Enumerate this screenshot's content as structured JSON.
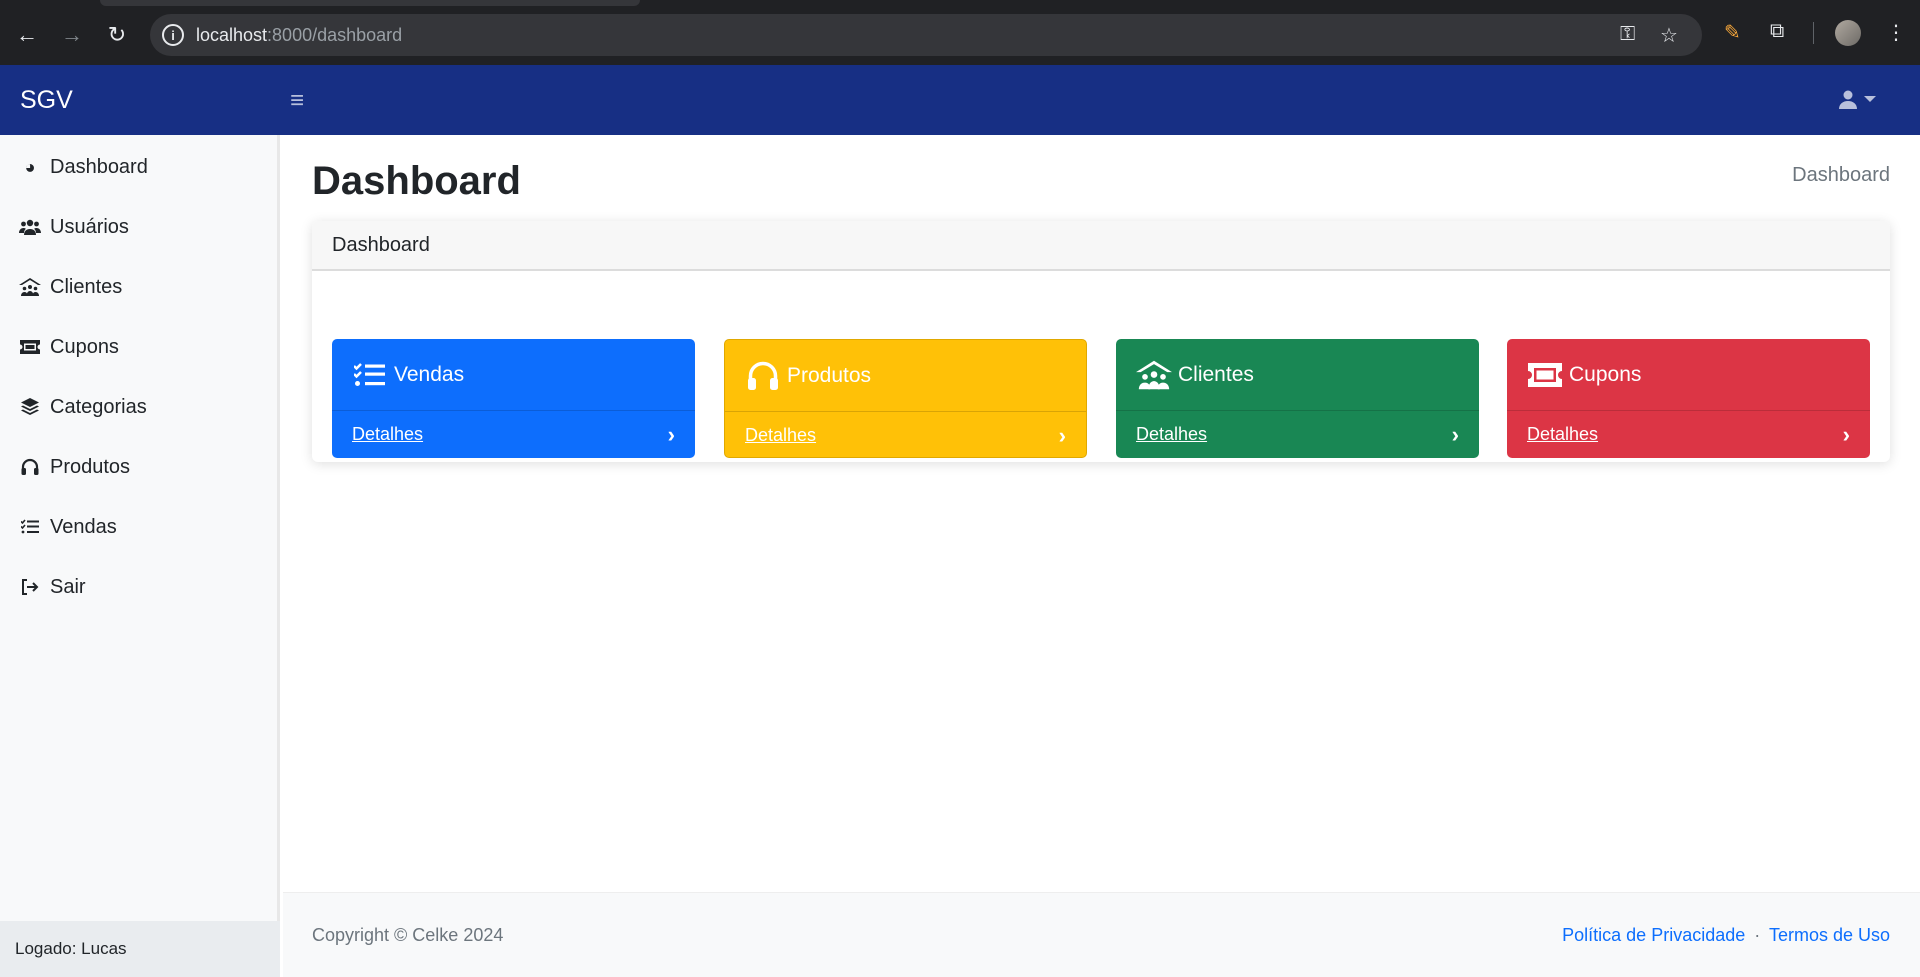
{
  "browser": {
    "url_host": "localhost",
    "url_path": ":8000/dashboard",
    "back_icon": "arrow-left-icon",
    "forward_icon": "arrow-right-icon",
    "reload_icon": "reload-icon"
  },
  "navbar": {
    "brand": "SGV",
    "toggle_icon": "hamburger-icon",
    "user_icon": "user-icon"
  },
  "sidebar": {
    "items": [
      {
        "label": "Dashboard",
        "icon": "gauge-icon"
      },
      {
        "label": "Usuários",
        "icon": "users-icon"
      },
      {
        "label": "Clientes",
        "icon": "people-roof-icon"
      },
      {
        "label": "Cupons",
        "icon": "ticket-icon"
      },
      {
        "label": "Categorias",
        "icon": "layer-group-icon"
      },
      {
        "label": "Produtos",
        "icon": "headphones-icon"
      },
      {
        "label": "Vendas",
        "icon": "list-check-icon"
      },
      {
        "label": "Sair",
        "icon": "sign-out-icon"
      }
    ],
    "footer": "Logado: Lucas"
  },
  "main": {
    "title": "Dashboard",
    "breadcrumb": "Dashboard",
    "card_header": "Dashboard",
    "tiles": [
      {
        "label": "Vendas",
        "link": "Detalhes",
        "color": "#0d6efd",
        "icon": "list-check-icon"
      },
      {
        "label": "Produtos",
        "link": "Detalhes",
        "color": "#ffc107",
        "icon": "headphones-icon"
      },
      {
        "label": "Clientes",
        "link": "Detalhes",
        "color": "#198754",
        "icon": "people-roof-icon"
      },
      {
        "label": "Cupons",
        "link": "Detalhes",
        "color": "#dc3545",
        "icon": "ticket-icon"
      }
    ]
  },
  "footer": {
    "copyright": "Copyright © Celke 2024",
    "privacy": "Política de Privacidade",
    "separator": "·",
    "terms": "Termos de Uso"
  }
}
